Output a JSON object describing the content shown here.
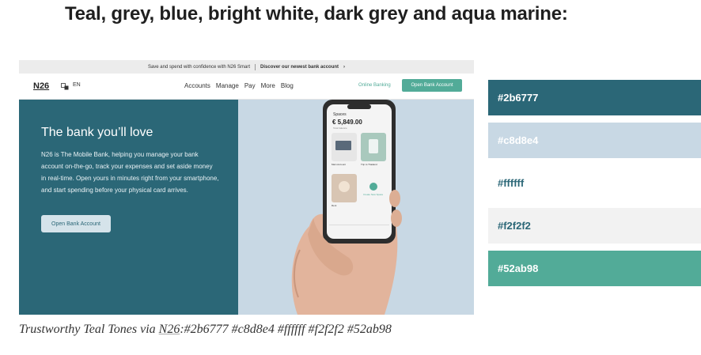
{
  "heading": "Teal, grey, blue, bright white, dark grey and aqua marine:",
  "site": {
    "topbar_left": "Save and spend with confidence with N26 Smart",
    "topbar_right": "Discover our newest bank account",
    "topbar_chevron": "›",
    "logo": "N26",
    "lang_icon": "translate-icon",
    "lang": "EN",
    "menu": [
      "Accounts",
      "Manage",
      "Pay",
      "More",
      "Blog"
    ],
    "online_banking": "Online Banking",
    "open_account": "Open Bank Account",
    "hero_title": "The bank you’ll love",
    "hero_text": "N26 is The Mobile Bank, helping you manage your bank account on-the-go, track your expenses and set aside money in real-time. Open yours in minutes right from your smartphone, and start spending before your physical card arrives.",
    "hero_button": "Open Bank Account",
    "phone": {
      "title": "Spaces",
      "balance": "€ 5,849.00",
      "balance_label": "Total balance",
      "card1": "Main Account",
      "card2": "Trip to Thailand",
      "card3": "Rent",
      "add": "Create New Space"
    }
  },
  "swatches": [
    {
      "label": "#2b6777",
      "bg": "#2b6777",
      "fg": "#ffffff"
    },
    {
      "label": "#c8d8e4",
      "bg": "#c8d8e4",
      "fg": "#ffffff"
    },
    {
      "label": "#ffffff",
      "bg": "#ffffff",
      "fg": "#2b6777"
    },
    {
      "label": "#f2f2f2",
      "bg": "#f2f2f2",
      "fg": "#2b6777"
    },
    {
      "label": "#52ab98",
      "bg": "#52ab98",
      "fg": "#ffffff"
    }
  ],
  "caption": {
    "prefix": "Trustworthy Teal Tones via ",
    "link": "N26",
    "suffix": ":#2b6777 #c8d8e4 #ffffff #f2f2f2 #52ab98"
  }
}
